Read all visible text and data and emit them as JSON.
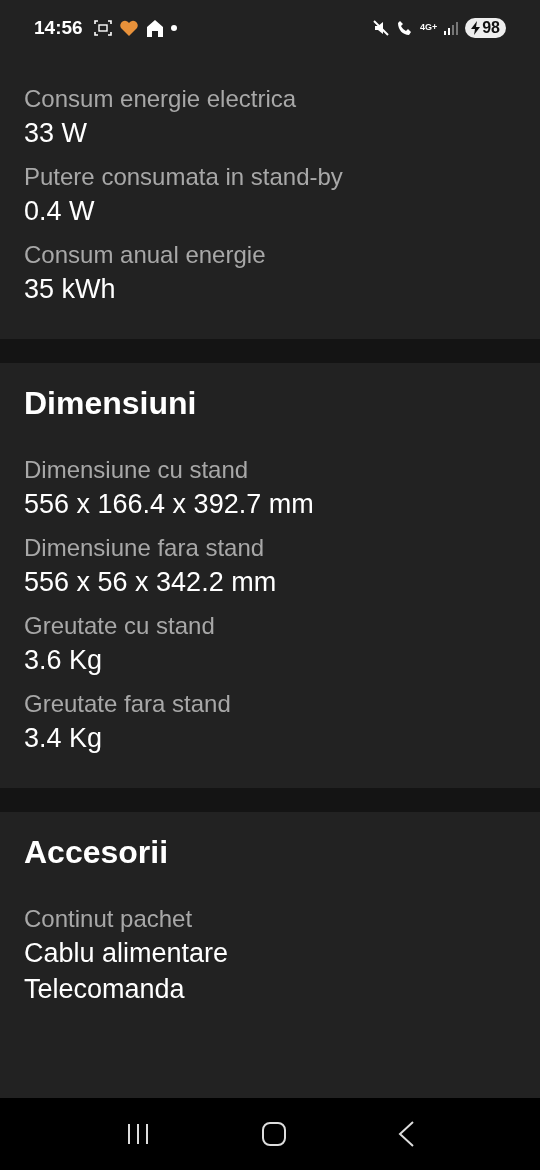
{
  "status_bar": {
    "time": "14:56",
    "network": "4G+",
    "battery": "98"
  },
  "sections": [
    {
      "items": [
        {
          "label": "Consum energie electrica",
          "value": "33 W"
        },
        {
          "label": "Putere consumata in stand-by",
          "value": "0.4 W"
        },
        {
          "label": "Consum anual energie",
          "value": "35 kWh"
        }
      ]
    },
    {
      "title": "Dimensiuni",
      "items": [
        {
          "label": "Dimensiune cu stand",
          "value": "556 x 166.4 x 392.7 mm"
        },
        {
          "label": "Dimensiune fara stand",
          "value": "556 x 56 x 342.2 mm"
        },
        {
          "label": "Greutate cu stand",
          "value": "3.6 Kg"
        },
        {
          "label": "Greutate fara stand",
          "value": "3.4 Kg"
        }
      ]
    },
    {
      "title": "Accesorii",
      "items": [
        {
          "label": "Continut pachet",
          "value": "Cablu alimentare\nTelecomanda"
        }
      ]
    }
  ]
}
